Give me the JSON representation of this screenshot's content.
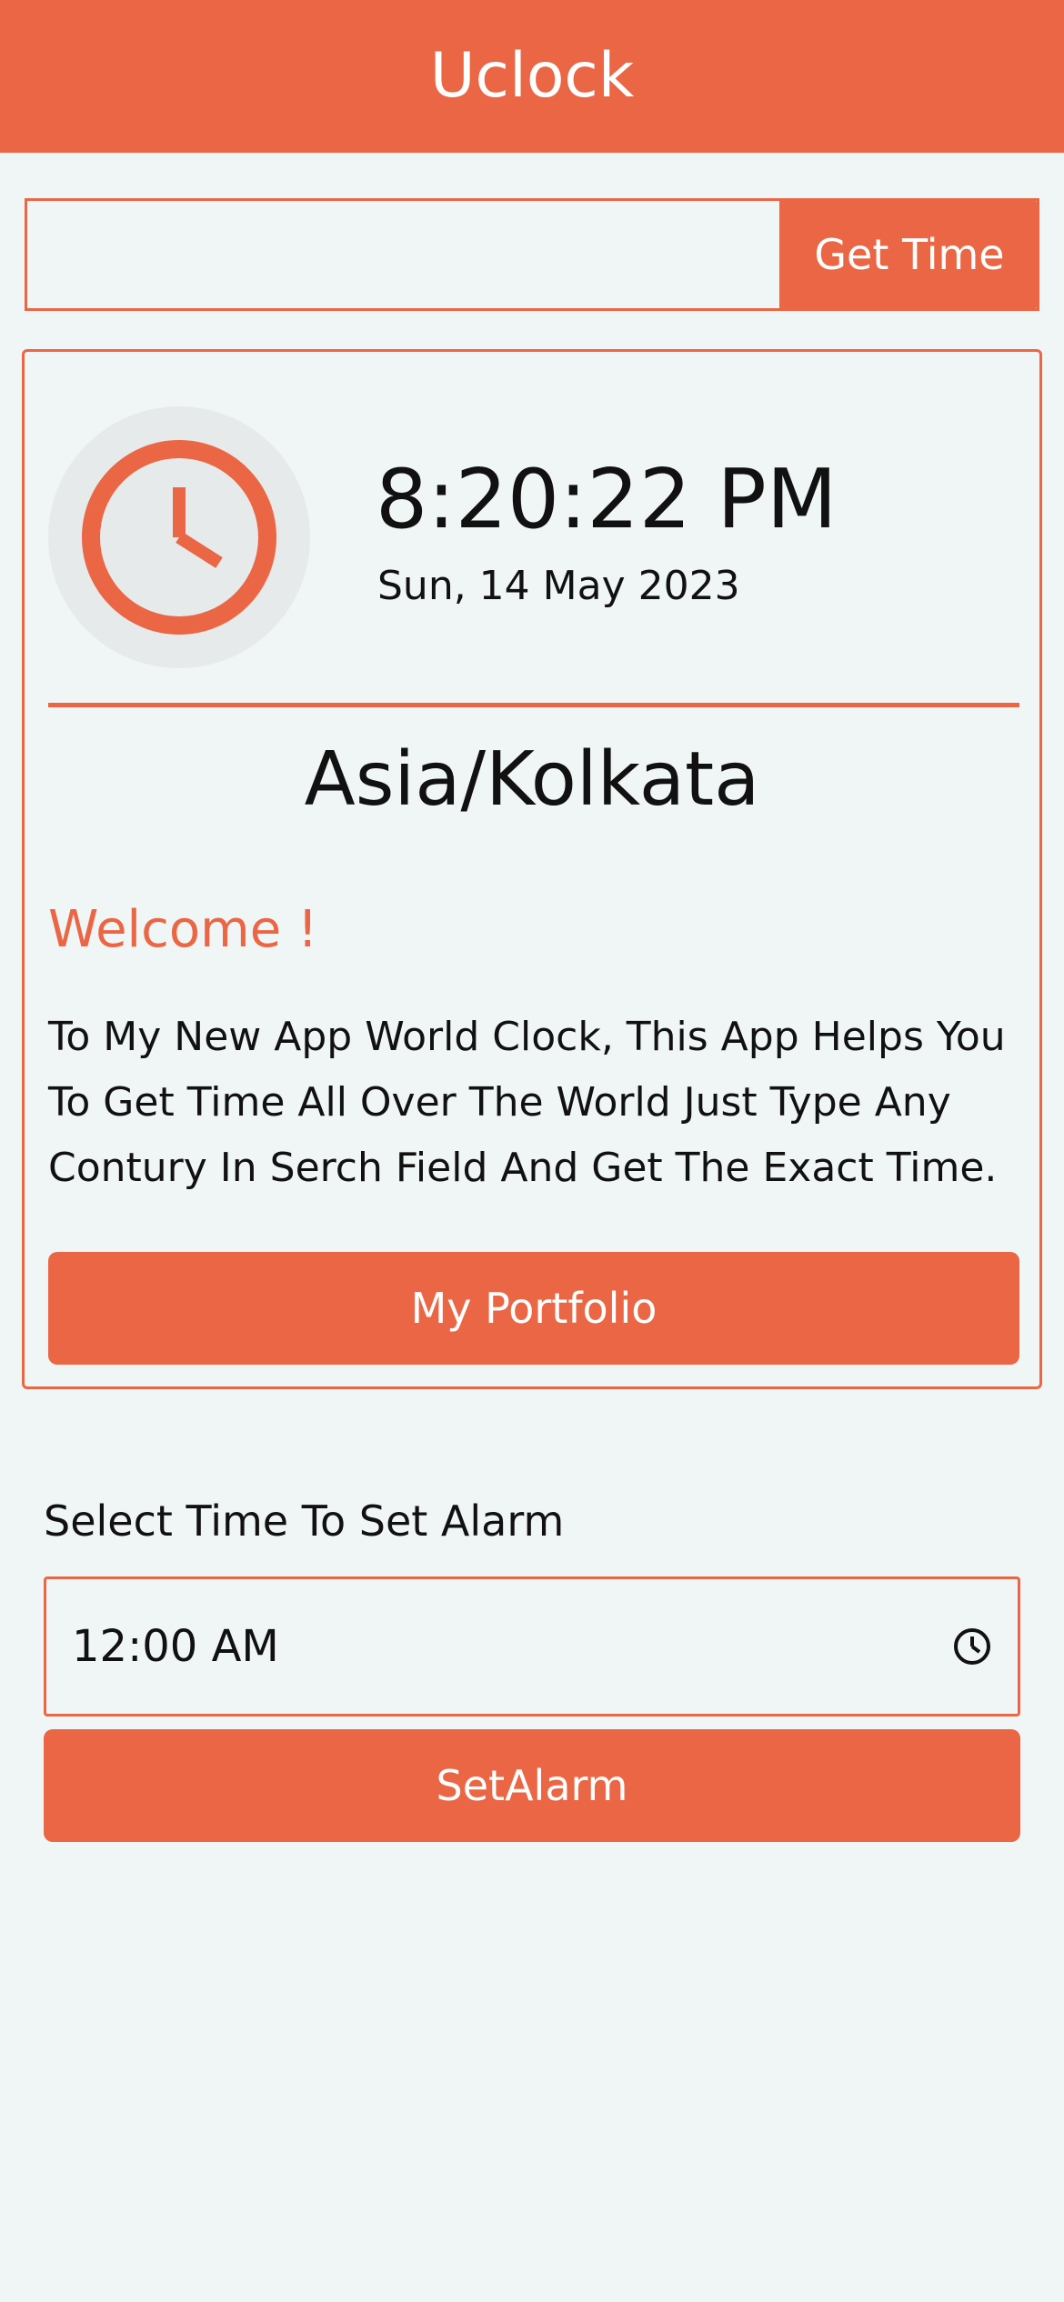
{
  "colors": {
    "accent": "#eb6644",
    "background": "#f0f5f6",
    "clock_badge": "#e7eaeb"
  },
  "header": {
    "title": "Uclock"
  },
  "search": {
    "value": "",
    "placeholder": "",
    "button_label": "Get Time"
  },
  "clock_card": {
    "icon": "clock-icon",
    "time": "8:20:22 PM",
    "date": "Sun, 14 May 2023",
    "timezone": "Asia/Kolkata",
    "welcome": "Welcome !",
    "description": "To My New App World Clock, This App Helps You To Get Time All Over The World Just Type Any Contury In Serch Field And Get The Exact Time.",
    "portfolio_label": "My Portfolio"
  },
  "alarm": {
    "label": "Select Time To Set Alarm",
    "time_value": "12:00  AM",
    "time_icon": "clock-icon",
    "button_label": "SetAlarm"
  }
}
